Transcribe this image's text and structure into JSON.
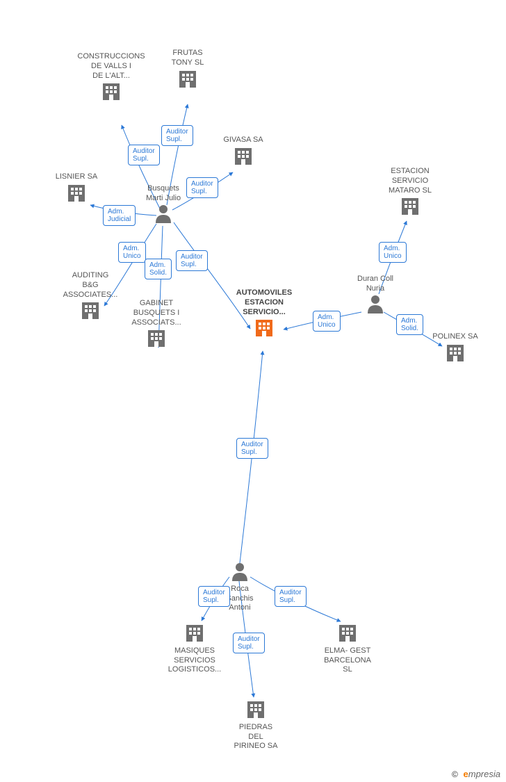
{
  "nodes": {
    "construccions": {
      "label": "CONSTRUCCIONS\nDE VALLS I\nDE L'ALT...",
      "type": "building"
    },
    "frutas": {
      "label": "FRUTAS\nTONY SL",
      "type": "building"
    },
    "givasa": {
      "label": "GIVASA SA",
      "type": "building"
    },
    "lisnier": {
      "label": "LISNIER SA",
      "type": "building"
    },
    "auditing": {
      "label": "AUDITING\nB&G\nASSOCIATES...",
      "type": "building"
    },
    "gabinet": {
      "label": "GABINET\nBUSQUETS I\nASSOCIATS...",
      "type": "building"
    },
    "busquets": {
      "label": "Busquets\nMarti Julio",
      "type": "person"
    },
    "automoviles": {
      "label": "AUTOMOVILES\nESTACION\nSERVICIO...",
      "type": "building",
      "center": true
    },
    "duran": {
      "label": "Duran Coll\nNuria",
      "type": "person"
    },
    "estacionmataro": {
      "label": "ESTACION\nSERVICIO\nMATARO SL",
      "type": "building"
    },
    "polinex": {
      "label": "POLINEX SA",
      "type": "building"
    },
    "roca": {
      "label": "Roca\nSanchis\nAntoni",
      "type": "person"
    },
    "masiques": {
      "label": "MASIQUES\nSERVICIOS\nLOGISTICOS...",
      "type": "building"
    },
    "piedras": {
      "label": "PIEDRAS\nDEL\nPIRINEO SA",
      "type": "building"
    },
    "elma": {
      "label": "ELMA- GEST\nBARCELONA\nSL",
      "type": "building"
    }
  },
  "rel": {
    "auditor_supl": "Auditor\nSupl.",
    "adm_judicial": "Adm.\nJudicial",
    "adm_unico": "Adm.\nUnico",
    "adm_solid": "Adm.\nSolid."
  },
  "watermark": {
    "copy": "©",
    "brand_e": "e",
    "brand_rest": "mpresia"
  },
  "colors": {
    "building": "#6f6f6f",
    "building_center": "#f06a1a",
    "person": "#6f6f6f",
    "edge": "#2b78d6",
    "text": "#555"
  }
}
